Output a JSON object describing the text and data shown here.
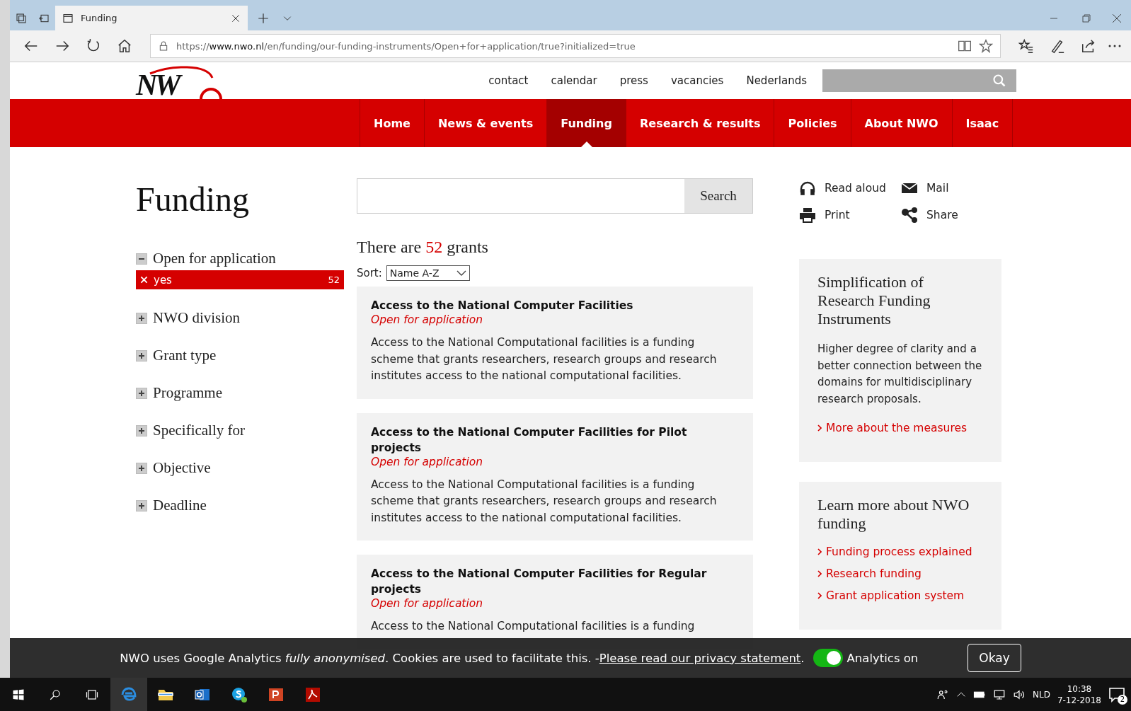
{
  "browser": {
    "tab_title": "Funding",
    "url_prefix": "https://",
    "url_host": "www.nwo.nl",
    "url_path": "/en/funding/our-funding-instruments/Open+for+application/true?initialized=true"
  },
  "site": {
    "logo": "NW",
    "top_links": [
      "contact",
      "calendar",
      "press",
      "vacancies",
      "Nederlands"
    ],
    "nav": [
      {
        "label": "Home",
        "selected": false
      },
      {
        "label": "News & events",
        "selected": false
      },
      {
        "label": "Funding",
        "selected": true
      },
      {
        "label": "Research & results",
        "selected": false
      },
      {
        "label": "Policies",
        "selected": false
      },
      {
        "label": "About NWO",
        "selected": false
      },
      {
        "label": "Isaac",
        "selected": false
      }
    ]
  },
  "page_title": "Funding",
  "facets": [
    {
      "label": "Open for application",
      "expanded": true,
      "values": [
        {
          "label": "yes",
          "count": "52",
          "selected": true
        }
      ]
    },
    {
      "label": "NWO division",
      "expanded": false
    },
    {
      "label": "Grant type",
      "expanded": false
    },
    {
      "label": "Programme",
      "expanded": false
    },
    {
      "label": "Specifically for",
      "expanded": false
    },
    {
      "label": "Objective",
      "expanded": false
    },
    {
      "label": "Deadline",
      "expanded": false
    }
  ],
  "search": {
    "button": "Search"
  },
  "results": {
    "prefix": "There are",
    "count": "52",
    "suffix": "grants",
    "sort_label": "Sort:",
    "sort_value": "Name A-Z",
    "items": [
      {
        "title": "Access to the National Computer Facilities",
        "status": "Open for application",
        "description": "Access to the National Computational facilities is a funding scheme that grants researchers, research groups and research institutes access to the national computational facilities."
      },
      {
        "title": "Access to the National Computer Facilities for Pilot projects",
        "status": "Open for application",
        "description": "Access to the National Computational facilities is a funding scheme that grants researchers, research groups and research institutes access to the national computational facilities."
      },
      {
        "title": "Access to the National Computer Facilities for Regular projects",
        "status": "Open for application",
        "description": "Access to the National Computational facilities is a funding"
      }
    ]
  },
  "tools": [
    {
      "kind": "headphones",
      "label": "Read aloud"
    },
    {
      "kind": "mail",
      "label": "Mail"
    },
    {
      "kind": "print",
      "label": "Print"
    },
    {
      "kind": "share",
      "label": "Share"
    }
  ],
  "sidebar": [
    {
      "title": "Simplification of Research Funding Instruments",
      "text": "Higher degree of clarity and a better connection between the domains for multidisciplinary research proposals.",
      "links": [
        "More about the measures"
      ]
    },
    {
      "title": "Learn more about NWO funding",
      "links": [
        "Funding process explained",
        "Research funding",
        "Grant application system"
      ]
    }
  ],
  "cookie_bar": {
    "text": "NWO uses Google Analytics *fully anonymised*. Cookies are used to facilitate this. - ",
    "link": "Please read our privacy statement",
    "after_link": ".",
    "toggle_on": true,
    "toggle_label": "Analytics on",
    "button": "Okay"
  },
  "taskbar": {
    "language": "NLD",
    "time": "10:38",
    "date": "7-12-2018",
    "notifications": "2"
  }
}
